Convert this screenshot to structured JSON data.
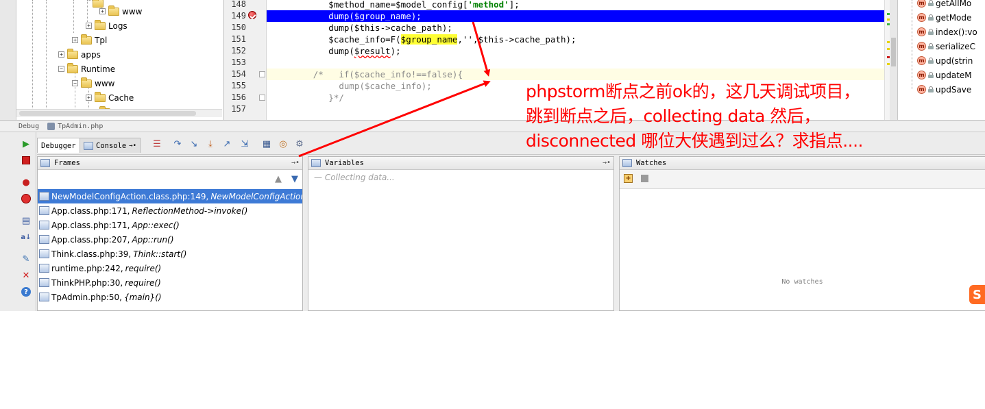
{
  "project_tree": {
    "items": [
      {
        "label": "www",
        "depth": 5,
        "expanded": false
      },
      {
        "label": "Logs",
        "depth": 4,
        "expanded": false
      },
      {
        "label": "Tpl",
        "depth": 3,
        "expanded": false
      },
      {
        "label": "apps",
        "depth": 2,
        "expanded": false
      },
      {
        "label": "Runtime",
        "depth": 2,
        "expanded": true
      },
      {
        "label": "www",
        "depth": 3,
        "expanded": true
      },
      {
        "label": "Cache",
        "depth": 4,
        "expanded": false
      }
    ]
  },
  "editor": {
    "line_numbers": [
      "148",
      "149",
      "150",
      "151",
      "152",
      "153",
      "154",
      "155",
      "156",
      "157"
    ],
    "breakpoint_line": "149",
    "lines": {
      "l148_a": "            $method_name=$model_config[",
      "l148_str": "'method'",
      "l148_b": "];",
      "l149": "            dump($group_name);",
      "l150": "            dump($this->cache_path);",
      "l151_a": "            $cache_info=F(",
      "l151_hl": "$group_name",
      "l151_b": ",'',$this->cache_path);",
      "l152_a": "            dump(",
      "l152_warn": "$result",
      "l152_b": ");",
      "l153": "",
      "l154": "         /*   if($cache_info!==false){",
      "l155": "              dump($cache_info);",
      "l156": "            }*/",
      "l157": ""
    }
  },
  "structure": {
    "items": [
      "getAllMo",
      "getMode",
      "index():vo",
      "serializeC",
      "upd(strin",
      "updateM",
      "updSave"
    ]
  },
  "debug_header": {
    "label": "Debug",
    "session": "TpAdmin.php"
  },
  "debug_tabs": {
    "debugger": "Debugger",
    "console": "Console"
  },
  "frames": {
    "title": "Frames",
    "items": [
      {
        "file": "NewModelConfigAction.class.php:149,",
        "method": "NewModelConfigAction"
      },
      {
        "file": "App.class.php:171,",
        "method": "ReflectionMethod->invoke()"
      },
      {
        "file": "App.class.php:171,",
        "method": "App::exec()"
      },
      {
        "file": "App.class.php:207,",
        "method": "App::run()"
      },
      {
        "file": "Think.class.php:39,",
        "method": "Think::start()"
      },
      {
        "file": "runtime.php:242,",
        "method": "require()"
      },
      {
        "file": "ThinkPHP.php:30,",
        "method": "require()"
      },
      {
        "file": "TpAdmin.php:50,",
        "method": "{main}()"
      }
    ]
  },
  "variables": {
    "title": "Variables",
    "status": "Collecting data..."
  },
  "watches": {
    "title": "Watches",
    "empty_text": "No watches"
  },
  "annotation": {
    "line1": "phpstorm断点之前ok的，这几天调试项目，",
    "line2": "跳到断点之后，collecting data 然后，",
    "line3": "disconnected 哪位大侠遇到过么？求指点....",
    "color": "#ff0000"
  },
  "colors": {
    "exec_line": "#0000ff",
    "selection": "#3d7ad6",
    "search_highlight": "#ffff33"
  }
}
